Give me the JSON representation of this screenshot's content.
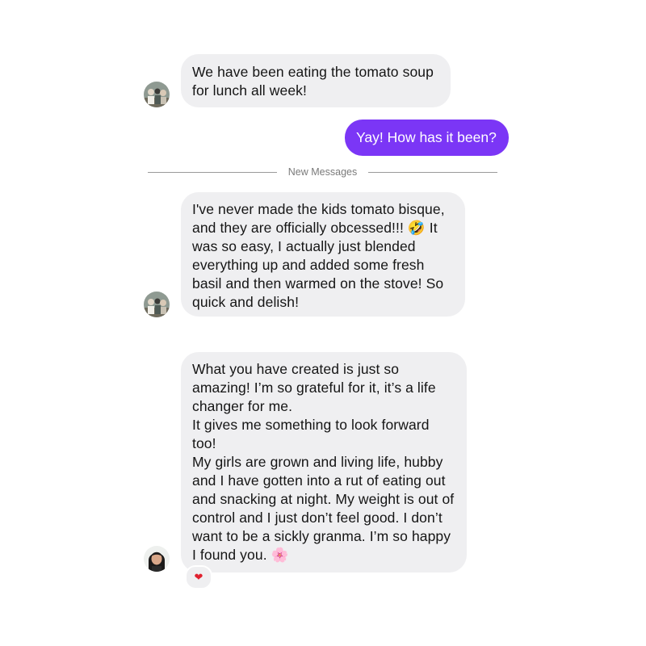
{
  "conversation": {
    "messages": [
      {
        "direction": "received",
        "text": "We have been eating the tomato soup for lunch all week!"
      },
      {
        "direction": "sent",
        "text": "Yay! How has it been?"
      },
      {
        "direction": "received",
        "text": "I've never made the kids tomato bisque, and they are officially obcessed!!! 🤣 It was so easy, I actually just blended everything up and added some fresh basil and then warmed on the stove! So quick and delish!"
      },
      {
        "direction": "received",
        "paragraphs": [
          "What you have created is just so amazing! I’m so grateful for it, it’s a life changer for me.",
          "It gives me something to look forward too!",
          "My girls are grown and living life,  hubby and I have gotten into a rut of eating out and snacking at night. My weight is out of control and I just don’t feel good. I don’t want to be a sickly granma. I’m so happy I found you. 🌸"
        ],
        "reaction": "❤"
      }
    ],
    "divider_label": "New Messages"
  },
  "colors": {
    "sent_bubble": "#7b36f6",
    "received_bubble": "#efeff1",
    "reaction_heart": "#e0212f"
  },
  "icons": {
    "avatar_1": "group-photo-avatar",
    "avatar_2": "woman-portrait-avatar"
  }
}
